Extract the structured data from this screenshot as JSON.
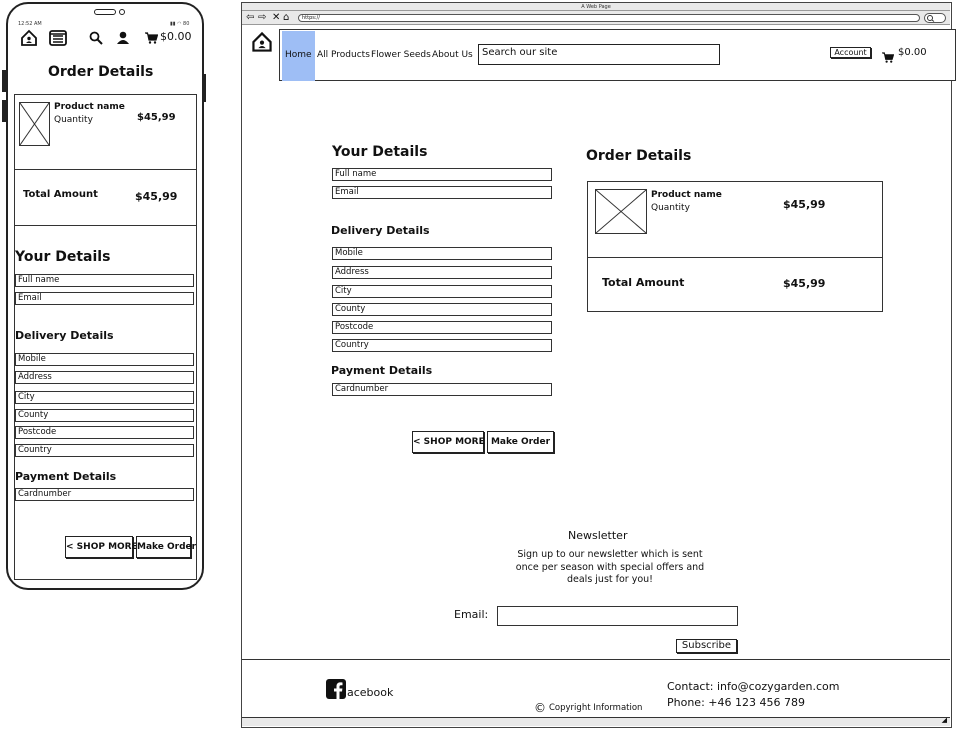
{
  "mobile": {
    "status": {
      "time": "12:52 AM",
      "battery": "80"
    },
    "header": {
      "cart_total": "$0.00",
      "icons": [
        "home-icon",
        "menu-icon",
        "search-icon",
        "user-icon",
        "cart-icon"
      ]
    },
    "page_title": "Order Details",
    "order": {
      "product_name": "Product name",
      "quantity_label": "Quantity",
      "price": "$45,99",
      "total_label": "Total Amount",
      "total": "$45,99"
    },
    "your_details": {
      "heading": "Your Details",
      "fields": [
        "Full name",
        "Email"
      ]
    },
    "delivery": {
      "heading": "Delivery Details",
      "fields": [
        "Mobile",
        "Address",
        "City",
        "County",
        "Postcode",
        "Country"
      ]
    },
    "payment": {
      "heading": "Payment Details",
      "fields": [
        "Cardnumber"
      ]
    },
    "buttons": {
      "shop_more": "< SHOP MORE",
      "make_order": "Make Order"
    }
  },
  "desktop": {
    "window_title": "A Web Page",
    "url": "https://",
    "nav": {
      "links": [
        "Home",
        "All Products",
        "Flower Seeds",
        "About Us"
      ],
      "active": "Home",
      "search_placeholder": "Search our site",
      "account_label": "Account",
      "cart_total": "$0.00"
    },
    "your_details": {
      "heading": "Your Details",
      "fields": [
        "Full name",
        "Email"
      ]
    },
    "delivery": {
      "heading": "Delivery Details",
      "fields": [
        "Mobile",
        "Address",
        "City",
        "County",
        "Postcode",
        "Country"
      ]
    },
    "payment": {
      "heading": "Payment Details",
      "fields": [
        "Cardnumber"
      ]
    },
    "buttons": {
      "shop_more": "< SHOP MORE",
      "make_order": "Make Order"
    },
    "order": {
      "heading": "Order Details",
      "product_name": "Product name",
      "quantity_label": "Quantity",
      "price": "$45,99",
      "total_label": "Total Amount",
      "total": "$45,99"
    },
    "newsletter": {
      "title": "Newsletter",
      "text_lines": [
        "Sign up to our newsletter which is sent",
        "once per season with special offers and",
        "deals just for you!"
      ],
      "email_label": "Email:",
      "subscribe_label": "Subscribe"
    },
    "footer": {
      "facebook_text": "acebook",
      "copyright": "Copyright Information",
      "contact": "Contact: info@cozygarden.com",
      "phone": "Phone: +46 123 456 789"
    }
  }
}
